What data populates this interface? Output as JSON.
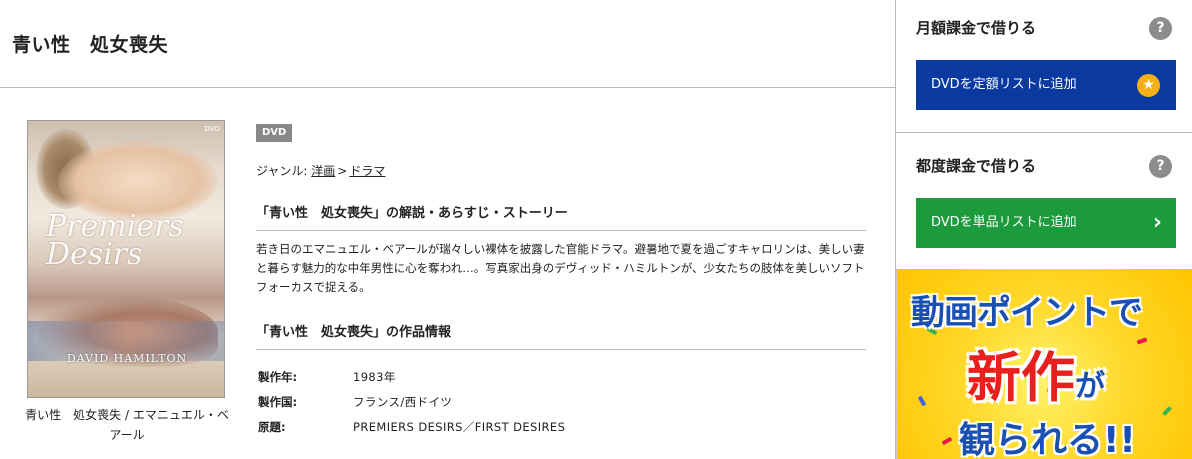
{
  "title": "青い性　処女喪失",
  "jacket": {
    "logo_text": "Premiers Desirs",
    "director_text": "DAVID HAMILTON",
    "mark": "DVD",
    "caption": "青い性　処女喪失 / エマニュエル・ベアール"
  },
  "media_badge": "DVD",
  "genre": {
    "label": "ジャンル:",
    "items": [
      "洋画",
      "ドラマ"
    ],
    "separator": ">"
  },
  "synopsis": {
    "heading": "「青い性　処女喪失」の解説・あらすじ・ストーリー",
    "text": "若き日のエマニュエル・ベアールが瑞々しい裸体を披露した官能ドラマ。避暑地で夏を過ごすキャロリンは、美しい妻と暮らす魅力的な中年男性に心を奪われ…。写真家出身のデヴィッド・ハミルトンが、少女たちの肢体を美しいソフトフォーカスで捉える。"
  },
  "info": {
    "heading": "「青い性　処女喪失」の作品情報",
    "rows": [
      {
        "label": "製作年:",
        "value": "1983年"
      },
      {
        "label": "製作国:",
        "value": "フランス/西ドイツ"
      },
      {
        "label": "原題:",
        "value": "PREMIERS DESIRS／FIRST DESIRES"
      }
    ]
  },
  "sidebar": {
    "monthly": {
      "heading": "月額課金で借りる",
      "help": "?",
      "button": "DVDを定額リストに追加",
      "button_icon": "star-icon"
    },
    "per_rental": {
      "heading": "都度課金で借りる",
      "help": "?",
      "button": "DVDを単品リストに追加",
      "button_icon": "chevron-right-icon"
    },
    "banner": {
      "line1": "動画ポイントで",
      "line2_main": "新作",
      "line2_small": "が",
      "line3": "観られる!!"
    }
  },
  "colors": {
    "blue_button": "#0a3aa0",
    "green_button": "#1c9b3c",
    "star": "#f6b015",
    "badge": "#888888",
    "banner_yellow": "#ffd82a",
    "banner_blue_text": "#1a4fb4",
    "banner_red_text": "#e8201d"
  }
}
